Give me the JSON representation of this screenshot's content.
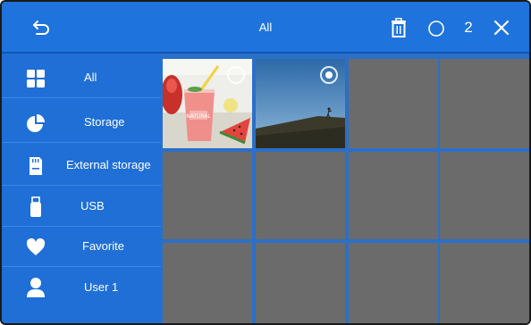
{
  "header": {
    "title": "All",
    "selected_count": "2",
    "icons": {
      "back": "back-arrow-icon",
      "delete": "trash-icon",
      "select_all": "circle-select-icon",
      "close": "close-icon"
    }
  },
  "sidebar": {
    "items": [
      {
        "label": "All",
        "icon": "grid-icon"
      },
      {
        "label": "Storage",
        "icon": "pie-chart-icon"
      },
      {
        "label": "External storage",
        "icon": "sd-card-icon"
      },
      {
        "label": "USB",
        "icon": "usb-icon"
      },
      {
        "label": "Favorite",
        "icon": "heart-icon"
      },
      {
        "label": "User 1",
        "icon": "user-icon"
      }
    ]
  },
  "thumbnails": [
    {
      "kind": "photo-drink",
      "selected": false
    },
    {
      "kind": "photo-hill",
      "selected": true
    }
  ],
  "colors": {
    "primary": "#1f73dc",
    "placeholder": "#6b6b6b"
  }
}
